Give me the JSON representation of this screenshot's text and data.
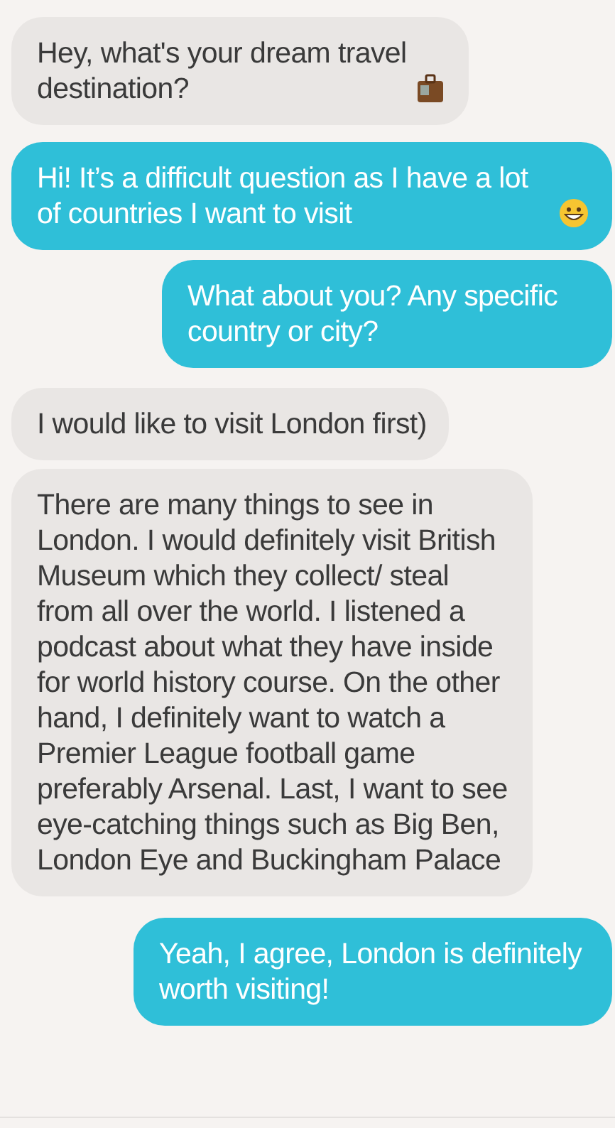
{
  "messages": [
    {
      "kind": "incoming",
      "text": "Hey, what's your dream travel destination?"
    },
    {
      "kind": "outgoing",
      "text": "Hi! It’s a difficult question as I have a lot of countries I want to visit"
    },
    {
      "kind": "outgoing",
      "text": "What about you? Any specific country or city?"
    },
    {
      "kind": "incoming",
      "text": "I would like to visit London first)"
    },
    {
      "kind": "incoming",
      "text": "There are many things to see in London. I would definitely visit British Museum which they collect/ steal from all over the world. I listened a podcast about what they have inside for world history course. On the other hand, I definitely want to watch a Premier League football game preferably Arsenal. Last, I want to see eye-catching things such as Big Ben, London Eye and Buckingham Palace"
    },
    {
      "kind": "outgoing",
      "text": "Yeah, I agree, London is definitely worth visiting!"
    }
  ]
}
